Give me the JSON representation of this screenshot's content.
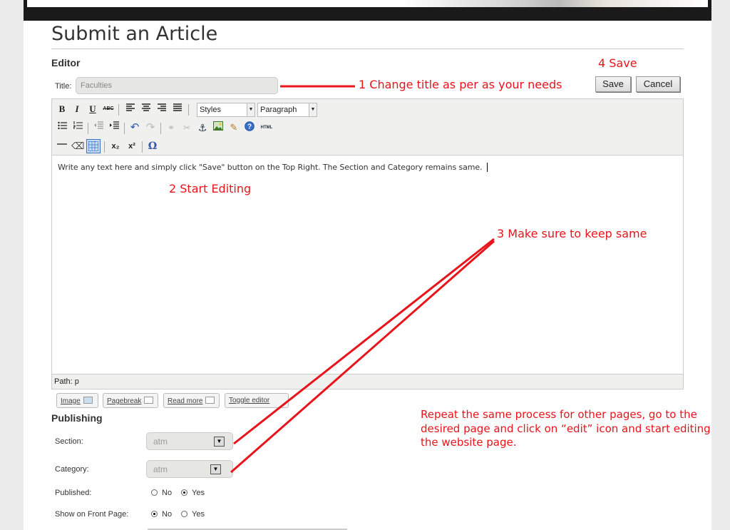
{
  "page": {
    "title": "Submit an Article"
  },
  "editor_section": {
    "heading": "Editor",
    "title_label": "Title:",
    "title_value": "Faculties"
  },
  "buttons": {
    "save": "Save",
    "cancel": "Cancel"
  },
  "toolbar": {
    "bold": "B",
    "italic": "I",
    "underline": "U",
    "strike": "ABC",
    "styles_value": "Styles",
    "format_value": "Paragraph",
    "html": "HTML",
    "subscript": "x₂",
    "superscript": "x²",
    "special_char": "Ω"
  },
  "content": {
    "text": "Write any text here and simply click \"Save\" button on the Top Right. The Section and Category remains same."
  },
  "pathbar": {
    "text": "Path: p"
  },
  "extra_buttons": {
    "image": "Image",
    "pagebreak": "Pagebreak",
    "readmore": "Read more",
    "toggle": "Toggle editor"
  },
  "publishing": {
    "heading": "Publishing",
    "section_label": "Section:",
    "section_value": "atm",
    "category_label": "Category:",
    "category_value": "atm",
    "published_label": "Published:",
    "published_no": "No",
    "published_yes": "Yes",
    "published_selected": "Yes",
    "frontpage_label": "Show on Front Page:",
    "frontpage_no": "No",
    "frontpage_yes": "Yes",
    "frontpage_selected": "No"
  },
  "annotations": {
    "a1": "1 Change title as per as your needs",
    "a2": "2 Start Editing",
    "a3": "3 Make sure to keep same",
    "a4": "4 Save",
    "note_line1": "Repeat the same process for other pages,  go to the",
    "note_line2": "desired page and click on “edit” icon and start editing",
    "note_line3": "the website page."
  },
  "colors": {
    "annotation": "#e8141b",
    "banner": "#1a1a1a"
  }
}
